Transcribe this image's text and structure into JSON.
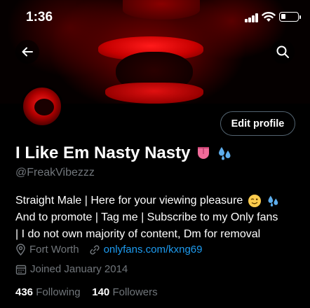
{
  "status_bar": {
    "time": "1:36"
  },
  "profile": {
    "display_name": "I Like Em Nasty Nasty",
    "handle": "@FreakVibezzz",
    "edit_label": "Edit profile",
    "bio_lines": [
      "Straight Male | Here for your viewing pleasure",
      "And to promote | Tag me | Subscribe to my Only fans",
      "| I do not own majority of content, Dm for removal"
    ],
    "location": "Fort Worth",
    "website": "onlyfans.com/kxng69",
    "joined": "Joined January 2014",
    "following_count": "436",
    "following_label": "Following",
    "followers_count": "140",
    "followers_label": "Followers"
  },
  "icons": {
    "back": "back-arrow-icon",
    "search": "search-icon",
    "location": "location-pin-icon",
    "link": "link-icon",
    "calendar": "calendar-icon"
  },
  "colors": {
    "accent": "#1d9bf0",
    "muted": "#71767b",
    "background": "#000000"
  }
}
